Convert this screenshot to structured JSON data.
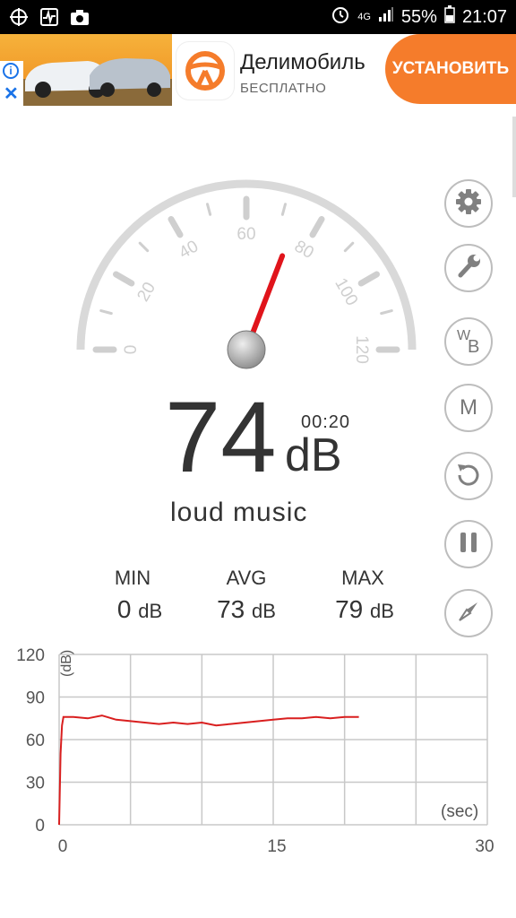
{
  "status_bar": {
    "battery": "55%",
    "time": "21:07",
    "network": "4G"
  },
  "ad": {
    "title": "Делимобиль",
    "subtitle": "БЕСПЛАТНО",
    "cta": "УСТАНОВИТЬ",
    "info_glyph": "i",
    "close_glyph": "✕"
  },
  "gauge": {
    "ticks": [
      "0",
      "20",
      "40",
      "60",
      "80",
      "100",
      "120"
    ],
    "value": 74,
    "max": 120
  },
  "reading": {
    "value": "74",
    "unit": "dB",
    "timer": "00:20",
    "description": "loud music"
  },
  "stats": {
    "min_label": "MIN",
    "min_value": "0",
    "avg_label": "AVG",
    "avg_value": "73",
    "max_label": "MAX",
    "max_value": "79",
    "unit": "dB"
  },
  "side_buttons": {
    "wb_w": "W",
    "wb_b": "B",
    "m": "M"
  },
  "colors": {
    "accent": "#f57c2b",
    "needle": "#e0141b",
    "trace": "#d91f1f"
  },
  "chart_data": {
    "type": "line",
    "ylabel": "(dB)",
    "xlabel": "(sec)",
    "ylim": [
      0,
      120
    ],
    "xlim": [
      0,
      30
    ],
    "yticks": [
      "120",
      "90",
      "60",
      "30",
      "0"
    ],
    "xticks": [
      "0",
      "15",
      "30"
    ],
    "grid": true,
    "series": [
      {
        "x": [
          0,
          0.1,
          0.2,
          0.3,
          1,
          2,
          3,
          4,
          5,
          6,
          7,
          8,
          9,
          10,
          11,
          12,
          13,
          14,
          15,
          16,
          17,
          18,
          19,
          20,
          21
        ],
        "values": [
          0,
          50,
          70,
          76,
          76,
          75,
          77,
          74,
          73,
          72,
          71,
          72,
          71,
          72,
          70,
          71,
          72,
          73,
          74,
          75,
          75,
          76,
          75,
          76,
          76
        ]
      }
    ]
  }
}
